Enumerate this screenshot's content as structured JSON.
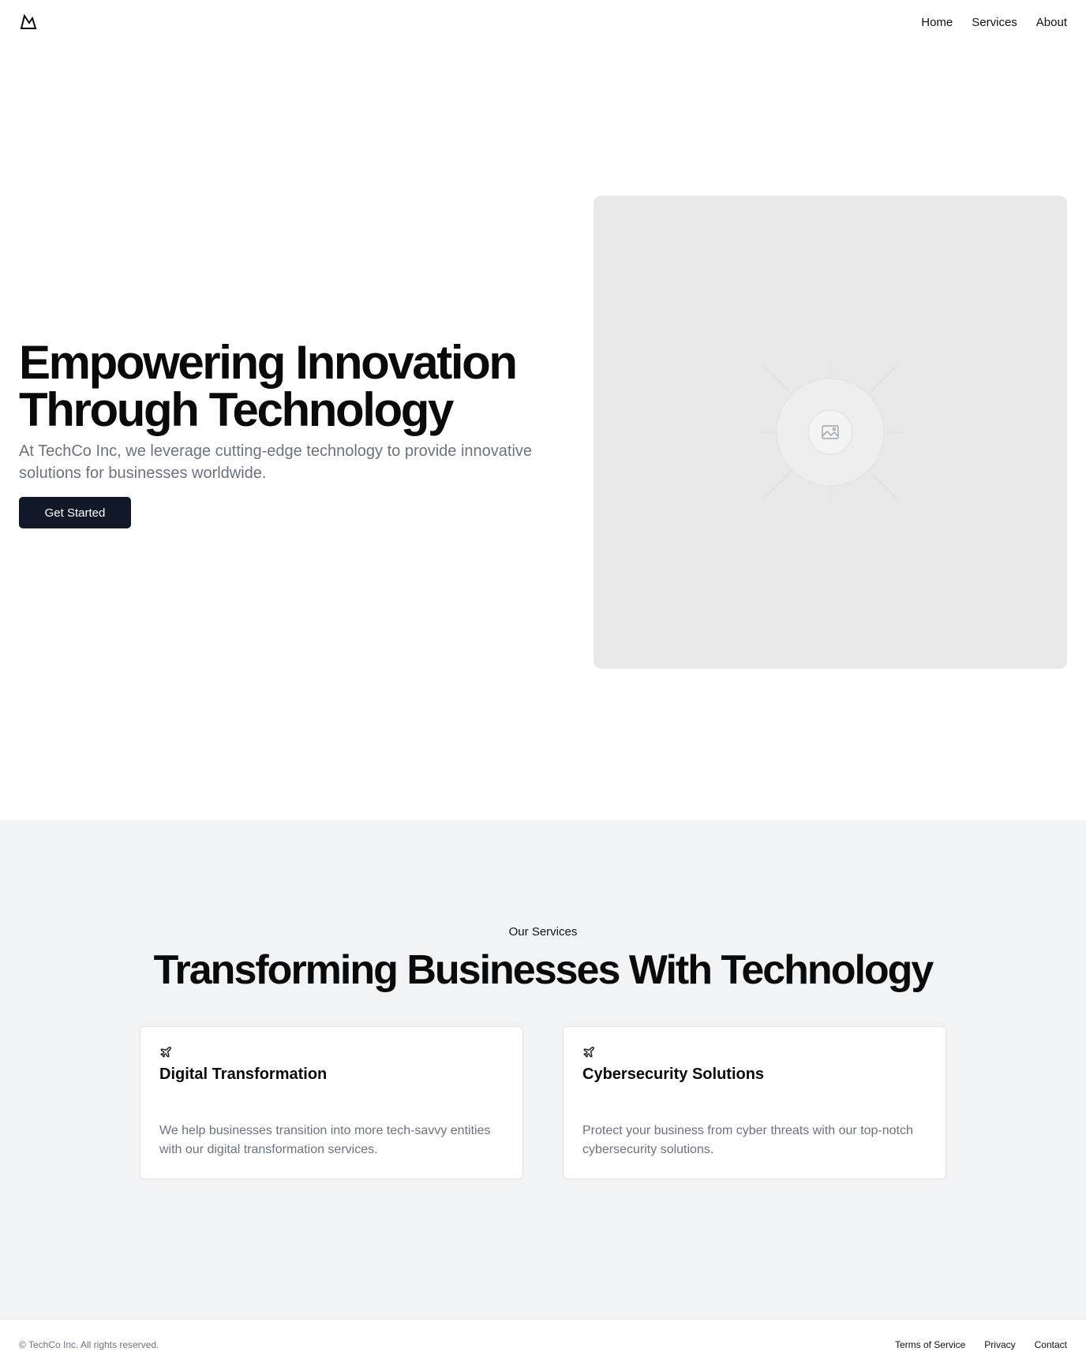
{
  "header": {
    "logo_icon": "mountain-icon",
    "nav": [
      {
        "label": "Home"
      },
      {
        "label": "Services"
      },
      {
        "label": "About"
      }
    ]
  },
  "hero": {
    "title_line1": "Empowering Innovation",
    "title_line2": "Through Technology",
    "subtitle": "At TechCo Inc, we leverage cutting-edge technology to provide innovative solutions for businesses worldwide.",
    "cta_label": "Get Started",
    "image_icon": "image-placeholder-icon"
  },
  "services": {
    "eyebrow": "Our Services",
    "title": "Transforming Businesses With Technology",
    "cards": [
      {
        "icon": "plane-icon",
        "title": "Digital Transformation",
        "description": "We help businesses transition into more tech-savvy entities with our digital transformation services."
      },
      {
        "icon": "plane-icon",
        "title": "Cybersecurity Solutions",
        "description": "Protect your business from cyber threats with our top-notch cybersecurity solutions."
      }
    ]
  },
  "footer": {
    "copyright": "© TechCo Inc. All rights reserved.",
    "links": [
      {
        "label": "Terms of Service"
      },
      {
        "label": "Privacy"
      },
      {
        "label": "Contact"
      }
    ]
  },
  "colors": {
    "primary_button": "#111827",
    "muted_text": "#6b7280",
    "section_bg": "#f2f3f5",
    "placeholder_bg": "#e8e8e8"
  }
}
